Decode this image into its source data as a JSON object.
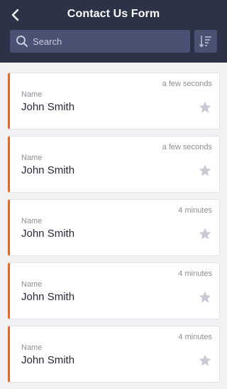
{
  "header": {
    "title": "Contact Us Form",
    "back_icon": "chevron-left-icon",
    "sort_icon": "sort-list-icon"
  },
  "search": {
    "placeholder": "Search",
    "value": "",
    "icon": "search-icon"
  },
  "colors": {
    "header_bg": "#2d3347",
    "search_bg": "#4a5172",
    "accent": "#e8652b",
    "star": "#c8cad6"
  },
  "records": [
    {
      "time": "a few seconds",
      "label": "Name",
      "value": "John Smith",
      "star_icon": "star-icon"
    },
    {
      "time": "a few seconds",
      "label": "Name",
      "value": "John Smith",
      "star_icon": "star-icon"
    },
    {
      "time": "4 minutes",
      "label": "Name",
      "value": "John Smith",
      "star_icon": "star-icon"
    },
    {
      "time": "4 minutes",
      "label": "Name",
      "value": "John Smith",
      "star_icon": "star-icon"
    },
    {
      "time": "4 minutes",
      "label": "Name",
      "value": "John Smith",
      "star_icon": "star-icon"
    }
  ]
}
